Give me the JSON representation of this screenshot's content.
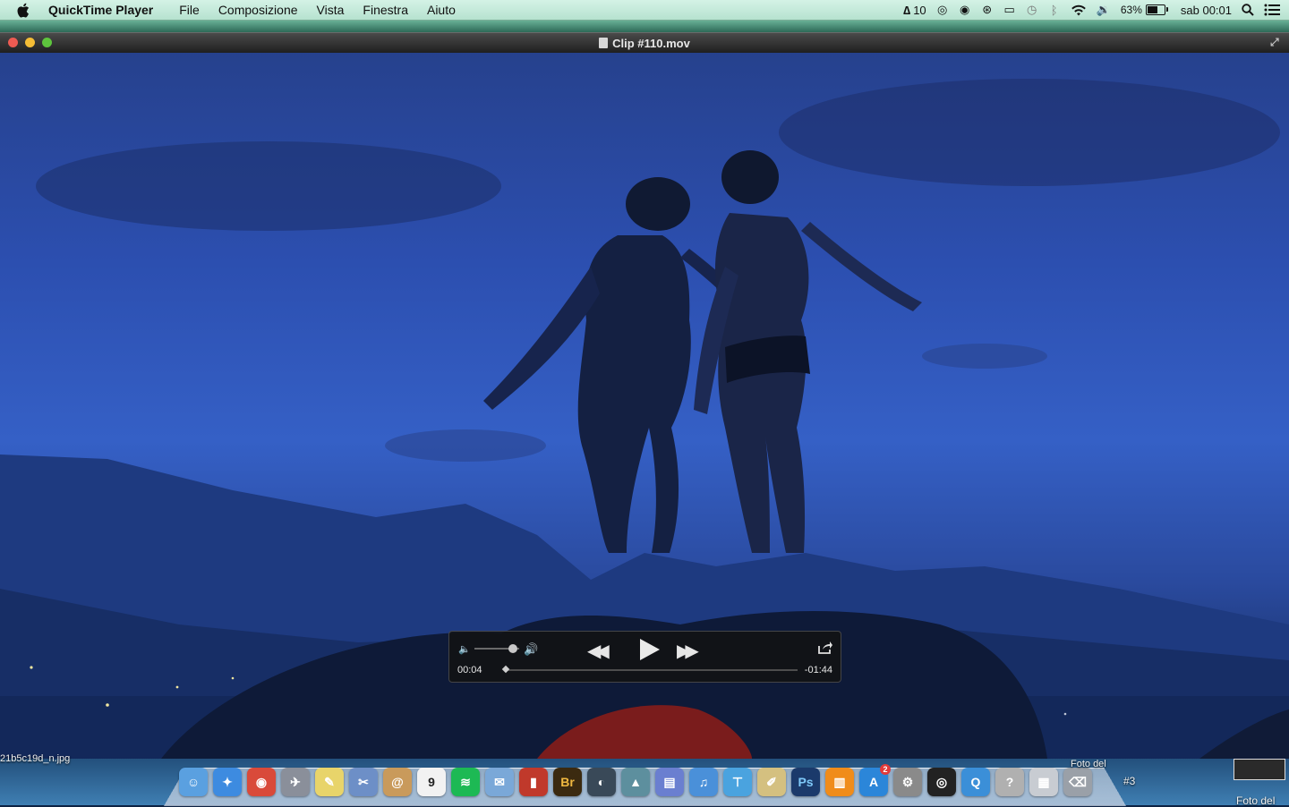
{
  "menubar": {
    "app_name": "QuickTime Player",
    "menus": [
      "File",
      "Composizione",
      "Vista",
      "Finestra",
      "Aiuto"
    ],
    "adobe_count": "10",
    "battery_percent": "63%",
    "battery_level": 0.63,
    "clock": "sab 00:01"
  },
  "window": {
    "title": "Clip #110.mov",
    "light_colors": [
      "#ee5b52",
      "#f5bd36",
      "#5ec53d"
    ]
  },
  "controls": {
    "current_time": "00:04",
    "remaining_time": "-01:44",
    "rewind_glyph": "◀◀",
    "forward_glyph": "▶▶",
    "volume_low_glyph": "🔈",
    "volume_high_glyph": "🔊"
  },
  "desktop": {
    "file_label": "21b5c19d_n.jpg",
    "photo_label_1": "Foto del",
    "photo_label_2": "#3",
    "photo_label_3": "Foto del"
  },
  "dock": {
    "items": [
      {
        "name": "finder-icon",
        "glyph": "☺",
        "color": "#5aa0e0"
      },
      {
        "name": "safari-icon",
        "glyph": "✦",
        "color": "#3d8be0"
      },
      {
        "name": "chrome-icon",
        "glyph": "◉",
        "color": "#d94a3a"
      },
      {
        "name": "launchpad-icon",
        "glyph": "✈",
        "color": "#8a8f9a"
      },
      {
        "name": "notes-icon",
        "glyph": "✎",
        "color": "#e8d46a"
      },
      {
        "name": "preview-icon",
        "glyph": "✂",
        "color": "#6d8fc7"
      },
      {
        "name": "contacts-icon",
        "glyph": "@",
        "color": "#c99a5b"
      },
      {
        "name": "calendar-icon",
        "glyph": "9",
        "color": "#f2f2f2"
      },
      {
        "name": "spotify-icon",
        "glyph": "≋",
        "color": "#1db954"
      },
      {
        "name": "mail-icon",
        "glyph": "✉",
        "color": "#7aa8d8"
      },
      {
        "name": "photo-booth-icon",
        "glyph": "▮",
        "color": "#c0392b"
      },
      {
        "name": "bridge-icon",
        "glyph": "Br",
        "color": "#3b2a10"
      },
      {
        "name": "lightroom-icon",
        "glyph": "◐",
        "color": "#394958"
      },
      {
        "name": "iphoto-icon",
        "glyph": "▲",
        "color": "#5d8f9e"
      },
      {
        "name": "keynote-icon",
        "glyph": "▤",
        "color": "#6a7fd0"
      },
      {
        "name": "itunes-icon",
        "glyph": "♫",
        "color": "#4a90d9"
      },
      {
        "name": "presentation-icon",
        "glyph": "⊤",
        "color": "#4aa3df"
      },
      {
        "name": "textedit-icon",
        "glyph": "✐",
        "color": "#d4c080"
      },
      {
        "name": "photoshop-icon",
        "glyph": "Ps",
        "color": "#1b3a6b"
      },
      {
        "name": "ibooks-icon",
        "glyph": "▥",
        "color": "#f08c1a"
      },
      {
        "name": "app-store-icon",
        "glyph": "A",
        "color": "#2b86d9"
      },
      {
        "name": "system-preferences-icon",
        "glyph": "⚙",
        "color": "#8a8a8a"
      },
      {
        "name": "dvd-player-icon",
        "glyph": "◎",
        "color": "#222222"
      },
      {
        "name": "quicktime-icon",
        "glyph": "Q",
        "color": "#3b8fd8"
      },
      {
        "name": "help-icon",
        "glyph": "?",
        "color": "#b0b0b0"
      },
      {
        "name": "downloads-stack-icon",
        "glyph": "▦",
        "color": "#c8ccd2"
      },
      {
        "name": "trash-icon",
        "glyph": "⌫",
        "color": "#9aa0a8"
      }
    ],
    "badge": "2"
  }
}
